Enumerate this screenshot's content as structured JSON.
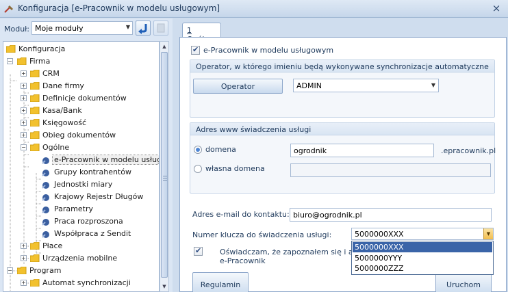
{
  "window": {
    "title": "Konfiguracja [e-Pracownik w modelu usługowym]",
    "close_glyph": "×"
  },
  "module": {
    "label": "Moduł:",
    "selected": "Moje moduły"
  },
  "tree": {
    "items": [
      {
        "label": "Konfiguracja"
      },
      {
        "label": "Firma"
      },
      {
        "label": "CRM"
      },
      {
        "label": "Dane firmy"
      },
      {
        "label": "Definicje dokumentów"
      },
      {
        "label": "Kasa/Bank"
      },
      {
        "label": "Księgowość"
      },
      {
        "label": "Obieg dokumentów"
      },
      {
        "label": "Ogólne"
      },
      {
        "label": "e-Pracownik w modelu usług"
      },
      {
        "label": "Grupy kontrahentów"
      },
      {
        "label": "Jednostki miary"
      },
      {
        "label": "Krajowy Rejestr Długów"
      },
      {
        "label": "Parametry"
      },
      {
        "label": "Praca rozproszona"
      },
      {
        "label": "Współpraca z Sendit"
      },
      {
        "label": "Płace"
      },
      {
        "label": "Urządzenia mobilne"
      },
      {
        "label": "Program"
      },
      {
        "label": "Automat synchronizacji"
      }
    ]
  },
  "tab": {
    "number": "1",
    "label": " Ogólne"
  },
  "form": {
    "epracownik_checkbox": "e-Pracownik w modelu usługowym",
    "operator_group_title": "Operator, w którego imieniu będą wykonywane synchronizacje automatyczne",
    "operator_button": "Operator",
    "operator_value": "ADMIN",
    "address_group_title": "Adres www świadczenia usługi",
    "domain_radio": "domena",
    "domain_value": "ogrodnik",
    "domain_suffix": ".epracownik.pl",
    "own_domain_radio": "własna domena",
    "email_label": "Adres e-mail do kontaktu:",
    "email_value": "biuro@ogrodnik.pl",
    "key_label": "Numer klucza do świadczenia usługi:",
    "key_value": "5000000XXX",
    "key_options": [
      "5000000XXX",
      "5000000YYY",
      "5000000ZZZ"
    ],
    "statement_line1": "Oświadczam, że zapoznałem się i akcept",
    "statement_line2": "e-Pracownik",
    "regulamin_button": "Regulamin",
    "uruchom_button": "Uruchom"
  },
  "colors": {
    "folder": "#f2c12e",
    "leaf": "#3b5fa0",
    "accent": "#3a64a8"
  }
}
